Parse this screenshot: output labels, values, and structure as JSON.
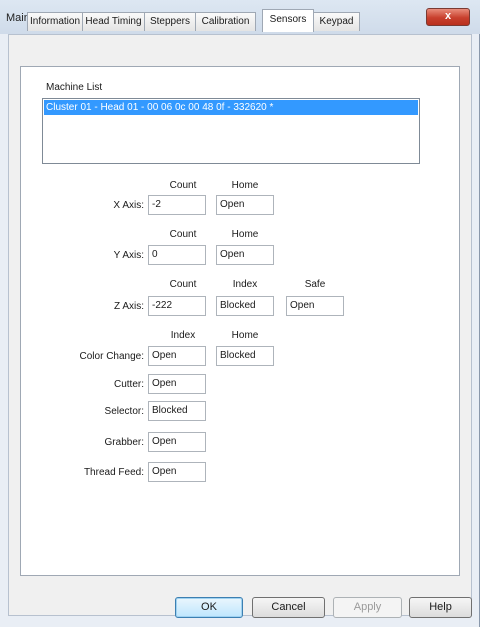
{
  "window": {
    "title": "Maintenance",
    "close_glyph": "x"
  },
  "tabs": [
    {
      "label": "Information",
      "active": false
    },
    {
      "label": "Head Timing",
      "active": false
    },
    {
      "label": "Steppers",
      "active": false
    },
    {
      "label": "Calibration",
      "active": false
    },
    {
      "label": "Sensors",
      "active": true
    },
    {
      "label": "Keypad",
      "active": false
    }
  ],
  "machine_list": {
    "label": "Machine List",
    "items": [
      {
        "text": "Cluster 01 - Head 01 - 00 06 0c 00 48 0f - 332620 *",
        "selected": true
      }
    ]
  },
  "sensors": {
    "x_axis": {
      "label": "X Axis:",
      "count_header": "Count",
      "count": "-2",
      "home_header": "Home",
      "home": "Open"
    },
    "y_axis": {
      "label": "Y Axis:",
      "count_header": "Count",
      "count": "0",
      "home_header": "Home",
      "home": "Open"
    },
    "z_axis": {
      "label": "Z Axis:",
      "count_header": "Count",
      "count": "-222",
      "index_header": "Index",
      "index": "Blocked",
      "safe_header": "Safe",
      "safe": "Open"
    },
    "color_change": {
      "label": "Color Change:",
      "index_header": "Index",
      "index": "Open",
      "home_header": "Home",
      "home": "Blocked"
    },
    "cutter": {
      "label": "Cutter:",
      "value": "Open"
    },
    "selector": {
      "label": "Selector:",
      "value": "Blocked"
    },
    "grabber": {
      "label": "Grabber:",
      "value": "Open"
    },
    "thread_feed": {
      "label": "Thread Feed:",
      "value": "Open"
    }
  },
  "buttons": {
    "ok": "OK",
    "cancel": "Cancel",
    "apply": "Apply",
    "help": "Help"
  },
  "colors": {
    "selection": "#3399ff",
    "close_button": "#c8402d",
    "title_bar": "#dde7f2"
  }
}
